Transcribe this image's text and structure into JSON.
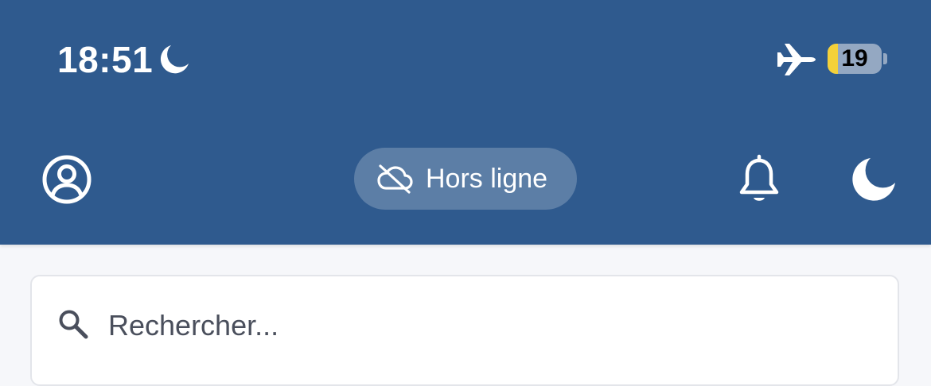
{
  "status_bar": {
    "time": "18:51",
    "focus_icon": "moon-icon",
    "connectivity_icon": "airplane-icon",
    "battery_level": "19",
    "battery_fraction": 0.19,
    "battery_fill_color": "#f4d13a"
  },
  "header": {
    "background_color": "#2f5a8e",
    "account_icon": "account-circle-icon",
    "status_pill": {
      "icon": "cloud-off-icon",
      "label": "Hors ligne"
    },
    "notifications_icon": "bell-icon",
    "theme_icon": "moon-icon"
  },
  "search": {
    "icon": "search-icon",
    "placeholder": "Rechercher..."
  }
}
